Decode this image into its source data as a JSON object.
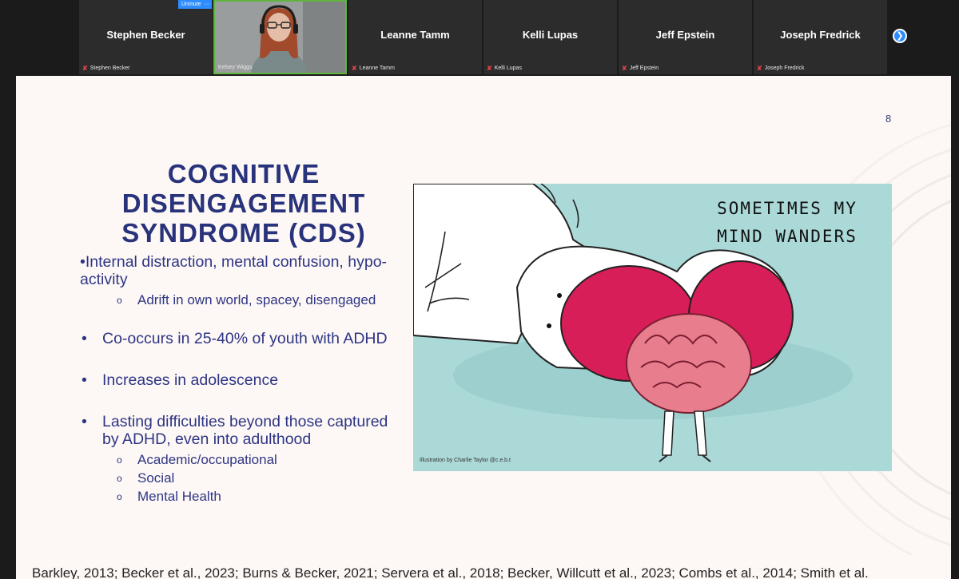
{
  "participants": [
    {
      "name": "Stephen Becker",
      "label": "Stephen Becker",
      "video": false
    },
    {
      "name": "Kelsey Wiggs",
      "label": "Kelsey Wiggs",
      "video": true
    },
    {
      "name": "Leanne Tamm",
      "label": "Leanne Tamm",
      "video": false
    },
    {
      "name": "Kelli Lupas",
      "label": "Kelli Lupas",
      "video": false
    },
    {
      "name": "Jeff Epstein",
      "label": "Jeff Epstein",
      "video": false
    },
    {
      "name": "Joseph Fredrick",
      "label": "Joseph Fredrick",
      "video": false
    }
  ],
  "controls": {
    "unmute_label": "Unmute",
    "more_label": "···",
    "next_icon": "chevron-right-icon"
  },
  "slide": {
    "page_number": "8",
    "title_lines": [
      "COGNITIVE",
      "DISENGAGEMENT",
      "SYNDROME (CDS)"
    ],
    "bullet1": "•Internal distraction, mental confusion, hypo-activity",
    "bullet1_sub": "Adrift in own world, spacey, disengaged",
    "bullet2": "Co-occurs in 25-40% of youth with ADHD",
    "bullet3": "Increases in adolescence",
    "bullet4": "Lasting difficulties beyond those captured by ADHD, even into adulthood",
    "bullet4_subs": [
      "Academic/occupational",
      "Social",
      "Mental Health"
    ],
    "illustration_text": [
      "SOMETIMES MY",
      "MIND WANDERS"
    ],
    "illustration_credit": "Illustration by Charlie Taylor @c.e.b.t",
    "references": "Barkley, 2013; Becker et al., 2023; Burns & Becker, 2021; Servera et al., 2018; Becker, Willcutt et al., 2023; Combs et al., 2014; Smith et al."
  },
  "colors": {
    "title": "#29337b",
    "bullet_text": "#2e3585",
    "illustration_bg": "#abd9d8",
    "active_border": "#5fb43e",
    "accent": "#2d8cff"
  }
}
